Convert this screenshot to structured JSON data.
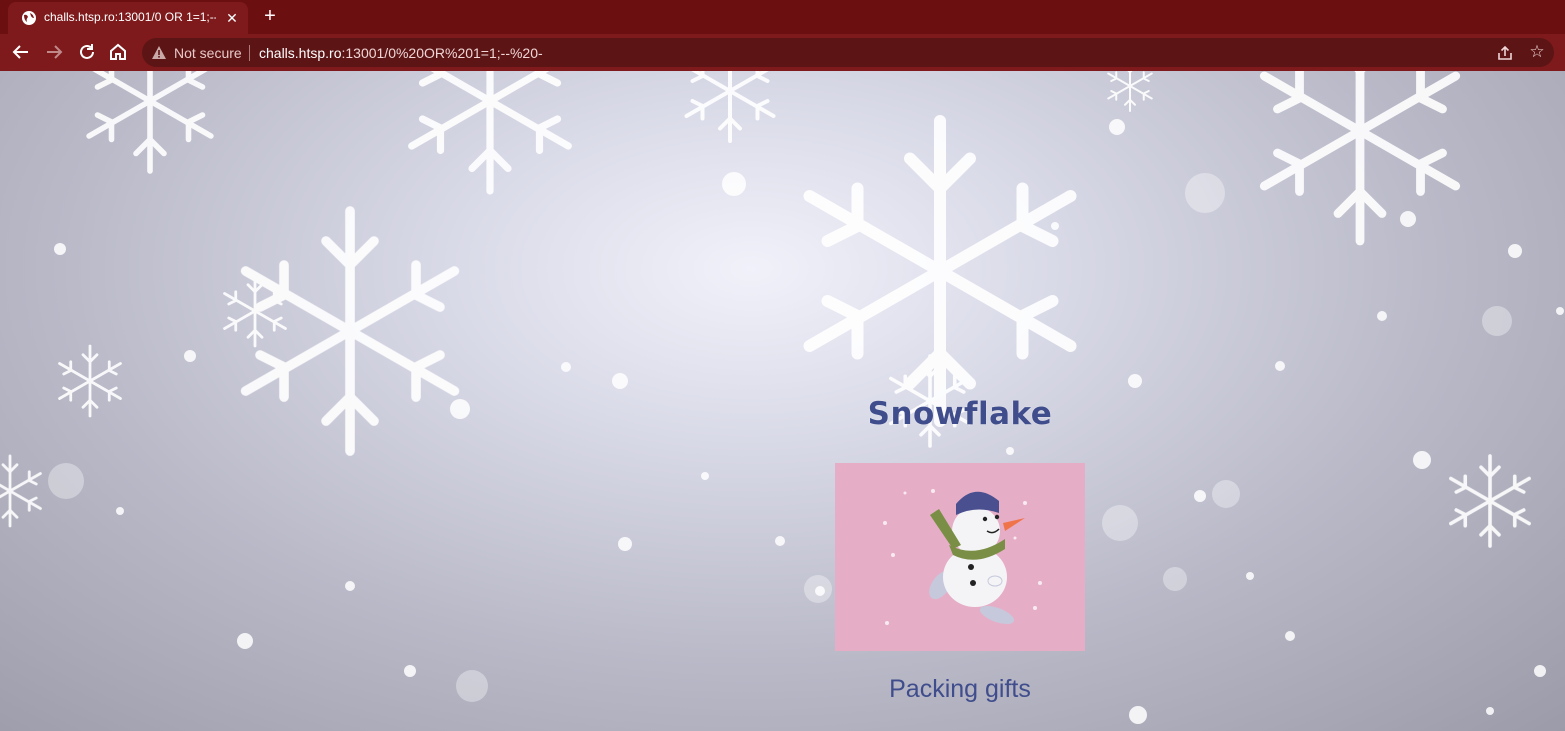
{
  "browser": {
    "tab": {
      "title": "challs.htsp.ro:13001/0 OR 1=1;--"
    },
    "address": {
      "security_label": "Not secure",
      "host": "challs.htsp.ro",
      "path": ":13001/0%20OR%201=1;--%20-"
    }
  },
  "page": {
    "heading": "Snowflake",
    "item": {
      "caption": "Packing gifts",
      "image_alt": "snowman ice skating illustration"
    }
  },
  "colors": {
    "tabstrip": "#6b0f10",
    "toolbar": "#7e1a1c",
    "heading": "#3f4d8c",
    "card_background": "#e6adc7"
  }
}
